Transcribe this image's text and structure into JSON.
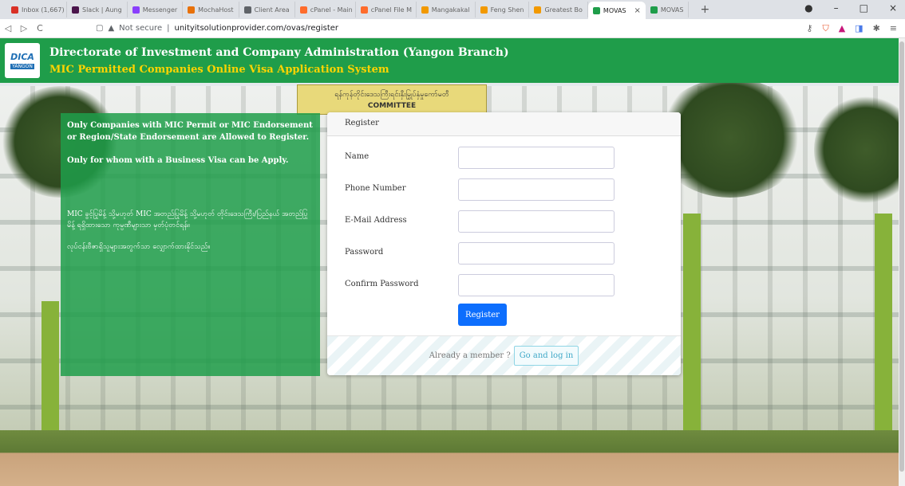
{
  "browser": {
    "tabs": [
      {
        "label": "Inbox (1,667)",
        "color": "#d93025"
      },
      {
        "label": "Slack | Aung",
        "color": "#4a154b"
      },
      {
        "label": "Messenger",
        "color": "#8a3ffc"
      },
      {
        "label": "MochaHost",
        "color": "#e8710a"
      },
      {
        "label": "Client Area",
        "color": "#5f6368"
      },
      {
        "label": "cPanel - Main",
        "color": "#ff6c2c"
      },
      {
        "label": "cPanel File M",
        "color": "#ff6c2c"
      },
      {
        "label": "Mangakakal",
        "color": "#f29900"
      },
      {
        "label": "Feng Shen",
        "color": "#f29900"
      },
      {
        "label": "Greatest Bo",
        "color": "#f29900"
      },
      {
        "label": "MOVAS",
        "color": "#1f9d4a",
        "active": true
      },
      {
        "label": "MOVAS",
        "color": "#1f9d4a"
      }
    ],
    "new_tab": "+",
    "security": "Not secure",
    "url": "unityitsolutionprovider.com/ovas/register"
  },
  "header": {
    "logo_text": "DICA",
    "logo_sub": "YANGON",
    "title": "Directorate of Investment and Company Administration (Yangon Branch)",
    "subtitle": "MIC Permitted Companies Online Visa Application System"
  },
  "background": {
    "sign_text": "ရန်ကုန်တိုင်းဒေသကြီးရင်းနှီးမြှုပ်နှံမှုကော်မတီ",
    "sign_sub": "COMMITTEE"
  },
  "info": {
    "en_1": "Only Companies with MIC Permit or MIC Endorsement or Region/State Endorsement are Allowed to Register.",
    "en_2": "Only for whom with a Business Visa can be Apply.",
    "mm_1": "MIC ခွင့်ပြုမိန့် သို့မဟုတ် MIC အတည်ပြုမိန့် သို့မဟုတ် တိုင်းဒေသကြီး/ပြည်နယ် အတည်ပြုမိန့် ရရှိထားသော ကုမ္ပဏီများသာ မှတ်ပုံတင်ရန်။",
    "mm_2": "လုပ်ငန်းဗီဇာရှိသူများအတွက်သာ လျှောက်ထားနိုင်သည်။"
  },
  "form": {
    "heading": "Register",
    "fields": [
      {
        "label": "Name",
        "value": ""
      },
      {
        "label": "Phone Number",
        "value": ""
      },
      {
        "label": "E-Mail Address",
        "value": ""
      },
      {
        "label": "Password",
        "value": ""
      },
      {
        "label": "Confirm Password",
        "value": ""
      }
    ],
    "submit_label": "Register",
    "footer_question": "Already a member ?",
    "login_label": "Go and log in"
  }
}
